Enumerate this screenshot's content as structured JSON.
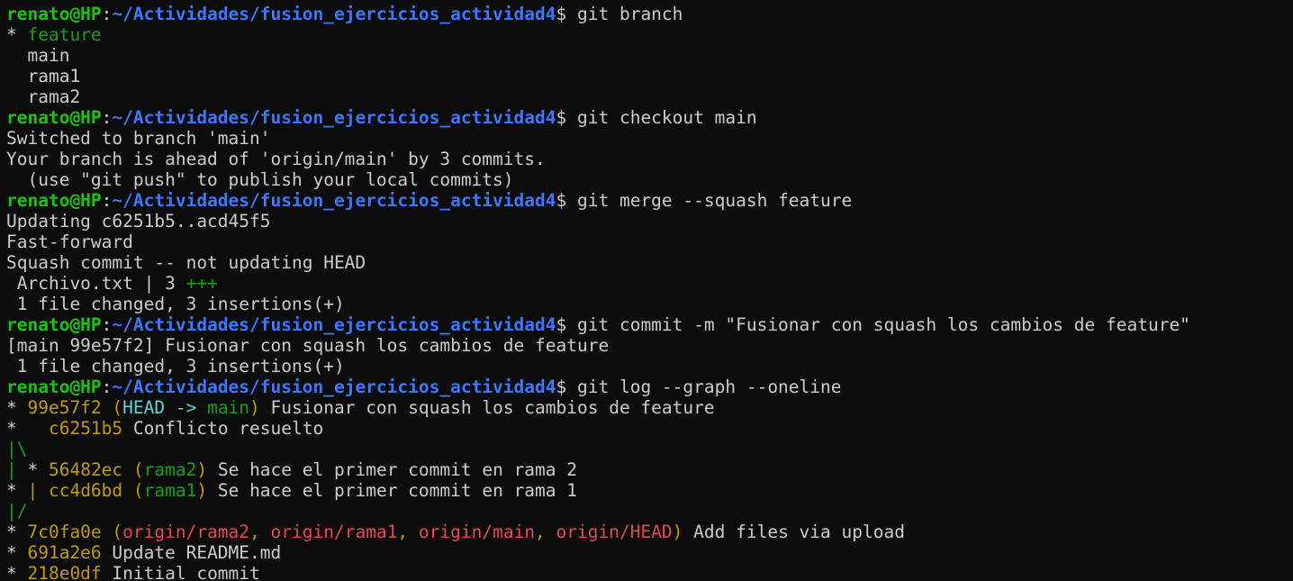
{
  "colors": {
    "background": "#0c0c0c",
    "default": "#cccccc",
    "green": "#13a10e",
    "bright_green": "#16c60c",
    "blue": "#3b78ff",
    "yellow": "#c19c00",
    "cyan": "#61d6d6",
    "red": "#e74856",
    "white": "#f2f2f2"
  },
  "prompt": {
    "user_host": "renato@HP",
    "separator": ":",
    "path": "~/Actividades/fusion_ejercicios_actividad4",
    "symbol": "$ "
  },
  "lines": [
    {
      "type": "prompt",
      "command": "git branch"
    },
    {
      "type": "text",
      "segments": [
        {
          "text": "* ",
          "color": "default"
        },
        {
          "text": "feature",
          "color": "green"
        }
      ]
    },
    {
      "type": "text",
      "segments": [
        {
          "text": "  main",
          "color": "default"
        }
      ]
    },
    {
      "type": "text",
      "segments": [
        {
          "text": "  rama1",
          "color": "default"
        }
      ]
    },
    {
      "type": "text",
      "segments": [
        {
          "text": "  rama2",
          "color": "default"
        }
      ]
    },
    {
      "type": "prompt",
      "command": "git checkout main"
    },
    {
      "type": "text",
      "segments": [
        {
          "text": "Switched to branch 'main'",
          "color": "default"
        }
      ]
    },
    {
      "type": "text",
      "segments": [
        {
          "text": "Your branch is ahead of 'origin/main' by 3 commits.",
          "color": "default"
        }
      ]
    },
    {
      "type": "text",
      "segments": [
        {
          "text": "  (use \"git push\" to publish your local commits)",
          "color": "default"
        }
      ]
    },
    {
      "type": "prompt",
      "command": "git merge --squash feature"
    },
    {
      "type": "text",
      "segments": [
        {
          "text": "Updating c6251b5..acd45f5",
          "color": "default"
        }
      ]
    },
    {
      "type": "text",
      "segments": [
        {
          "text": "Fast-forward",
          "color": "default"
        }
      ]
    },
    {
      "type": "text",
      "segments": [
        {
          "text": "Squash commit -- not updating HEAD",
          "color": "default"
        }
      ]
    },
    {
      "type": "text",
      "segments": [
        {
          "text": " Archivo.txt | 3 ",
          "color": "default"
        },
        {
          "text": "+++",
          "color": "green"
        }
      ]
    },
    {
      "type": "text",
      "segments": [
        {
          "text": " 1 file changed, 3 insertions(+)",
          "color": "default"
        }
      ]
    },
    {
      "type": "prompt",
      "command": "git commit -m \"Fusionar con squash los cambios de feature\""
    },
    {
      "type": "text",
      "segments": [
        {
          "text": "[main 99e57f2] Fusionar con squash los cambios de feature",
          "color": "default"
        }
      ]
    },
    {
      "type": "text",
      "segments": [
        {
          "text": " 1 file changed, 3 insertions(+)",
          "color": "default"
        }
      ]
    },
    {
      "type": "prompt",
      "command": "git log --graph --oneline"
    },
    {
      "type": "text",
      "segments": [
        {
          "text": "* ",
          "color": "default"
        },
        {
          "text": "99e57f2 ",
          "color": "yellow"
        },
        {
          "text": "(",
          "color": "yellow"
        },
        {
          "text": "HEAD -> ",
          "color": "cyan"
        },
        {
          "text": "main",
          "color": "green"
        },
        {
          "text": ")",
          "color": "yellow"
        },
        {
          "text": " Fusionar con squash los cambios de feature",
          "color": "default"
        }
      ]
    },
    {
      "type": "text",
      "segments": [
        {
          "text": "*   ",
          "color": "default"
        },
        {
          "text": "c6251b5",
          "color": "yellow"
        },
        {
          "text": " Conflicto resuelto",
          "color": "default"
        }
      ]
    },
    {
      "type": "text",
      "segments": [
        {
          "text": "|\\",
          "color": "green"
        }
      ]
    },
    {
      "type": "text",
      "segments": [
        {
          "text": "|",
          "color": "green"
        },
        {
          "text": " * ",
          "color": "default"
        },
        {
          "text": "56482ec ",
          "color": "yellow"
        },
        {
          "text": "(",
          "color": "yellow"
        },
        {
          "text": "rama2",
          "color": "green"
        },
        {
          "text": ")",
          "color": "yellow"
        },
        {
          "text": " Se hace el primer commit en rama 2",
          "color": "default"
        }
      ]
    },
    {
      "type": "text",
      "segments": [
        {
          "text": "* ",
          "color": "default"
        },
        {
          "text": "|",
          "color": "yellow"
        },
        {
          "text": " cc4d6bd ",
          "color": "yellow"
        },
        {
          "text": "(",
          "color": "yellow"
        },
        {
          "text": "rama1",
          "color": "green"
        },
        {
          "text": ")",
          "color": "yellow"
        },
        {
          "text": " Se hace el primer commit en rama 1",
          "color": "default"
        }
      ]
    },
    {
      "type": "text",
      "segments": [
        {
          "text": "|/",
          "color": "green"
        }
      ]
    },
    {
      "type": "text",
      "segments": [
        {
          "text": "* ",
          "color": "default"
        },
        {
          "text": "7c0fa0e ",
          "color": "yellow"
        },
        {
          "text": "(",
          "color": "yellow"
        },
        {
          "text": "origin/rama2",
          "color": "red"
        },
        {
          "text": ", ",
          "color": "yellow"
        },
        {
          "text": "origin/rama1",
          "color": "red"
        },
        {
          "text": ", ",
          "color": "yellow"
        },
        {
          "text": "origin/main",
          "color": "red"
        },
        {
          "text": ", ",
          "color": "yellow"
        },
        {
          "text": "origin/HEAD",
          "color": "red"
        },
        {
          "text": ")",
          "color": "yellow"
        },
        {
          "text": " Add files via upload",
          "color": "default"
        }
      ]
    },
    {
      "type": "text",
      "segments": [
        {
          "text": "* ",
          "color": "default"
        },
        {
          "text": "691a2e6",
          "color": "yellow"
        },
        {
          "text": " Update README.md",
          "color": "default"
        }
      ]
    },
    {
      "type": "text",
      "segments": [
        {
          "text": "* ",
          "color": "default"
        },
        {
          "text": "218e0df",
          "color": "yellow"
        },
        {
          "text": " Initial commit",
          "color": "default"
        }
      ]
    }
  ]
}
